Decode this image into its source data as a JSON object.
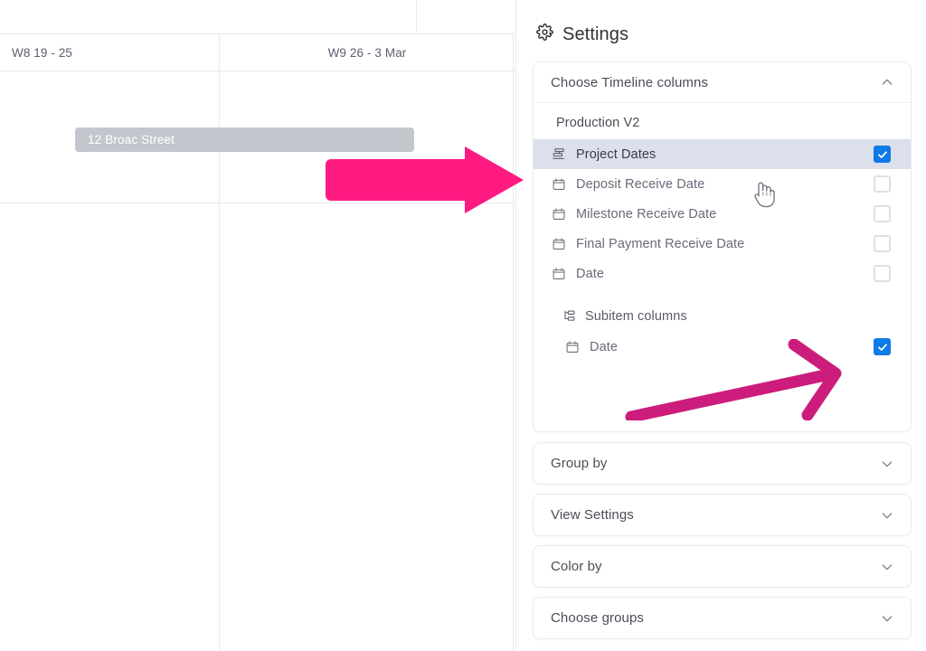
{
  "timeline": {
    "week_headers": [
      {
        "label": "W8 19 - 25"
      },
      {
        "label": "W9 26 - 3 Mar"
      }
    ],
    "bars": [
      {
        "label": "12 Broac Street",
        "color": "#c3c6cd"
      }
    ]
  },
  "annotations": {
    "arrow_right": {
      "name": "pink-arrow-right",
      "color": "#FF1A82"
    },
    "arrow_diagonal": {
      "name": "magenta-arrow-diagonal",
      "color": "#CC1C7C"
    }
  },
  "panel": {
    "title": "Settings",
    "gear_icon": "gear-icon",
    "sections": [
      {
        "id": "choose-timeline-columns",
        "label": "Choose Timeline columns",
        "expanded": true,
        "chevron": "chevron-up-icon",
        "group_title": "Production V2",
        "columns": [
          {
            "label": "Project Dates",
            "icon": "timeline-icon",
            "checked": true,
            "highlighted": true
          },
          {
            "label": "Deposit Receive Date",
            "icon": "calendar-icon",
            "checked": false,
            "highlighted": false
          },
          {
            "label": "Milestone Receive Date",
            "icon": "calendar-icon",
            "checked": false,
            "highlighted": false
          },
          {
            "label": "Final Payment Receive Date",
            "icon": "calendar-icon",
            "checked": false,
            "highlighted": false
          },
          {
            "label": "Date",
            "icon": "calendar-icon",
            "checked": false,
            "highlighted": false
          }
        ],
        "subitem_group": {
          "label": "Subitem columns",
          "icon": "subitem-icon",
          "columns": [
            {
              "label": "Date",
              "icon": "calendar-icon",
              "checked": true
            }
          ]
        }
      },
      {
        "id": "group-by",
        "label": "Group by",
        "expanded": false,
        "chevron": "chevron-down-icon"
      },
      {
        "id": "view-settings",
        "label": "View Settings",
        "expanded": false,
        "chevron": "chevron-down-icon"
      },
      {
        "id": "color-by",
        "label": "Color by",
        "expanded": false,
        "chevron": "chevron-down-icon"
      },
      {
        "id": "choose-groups",
        "label": "Choose groups",
        "expanded": false,
        "chevron": "chevron-down-icon"
      }
    ]
  },
  "colors": {
    "checkbox_checked": "#0e7ae5",
    "row_highlight": "#dcdfec",
    "bar_gray": "#c3c6cd",
    "grid_line": "#e6e9ef"
  }
}
